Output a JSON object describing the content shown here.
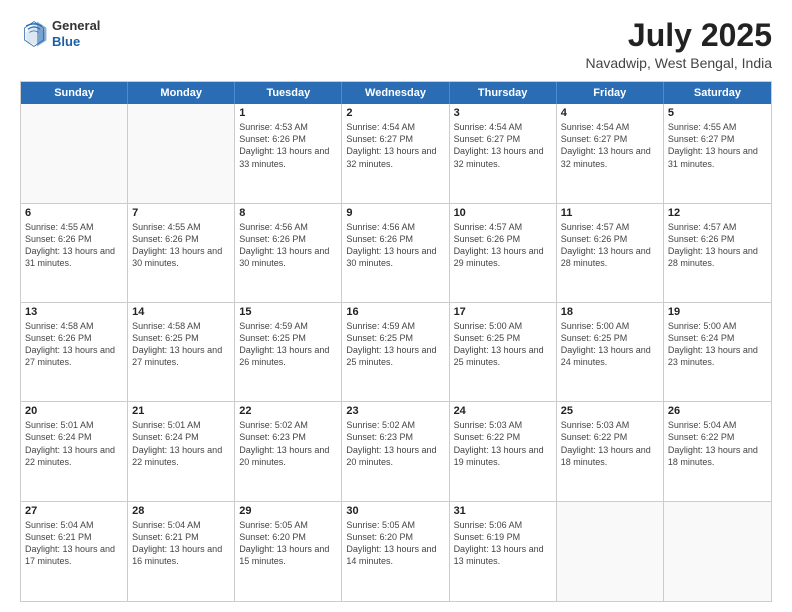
{
  "logo": {
    "general": "General",
    "blue": "Blue"
  },
  "title": {
    "month_year": "July 2025",
    "location": "Navadwip, West Bengal, India"
  },
  "header_days": [
    "Sunday",
    "Monday",
    "Tuesday",
    "Wednesday",
    "Thursday",
    "Friday",
    "Saturday"
  ],
  "weeks": [
    [
      {
        "day": "",
        "sunrise": "",
        "sunset": "",
        "daylight": ""
      },
      {
        "day": "",
        "sunrise": "",
        "sunset": "",
        "daylight": ""
      },
      {
        "day": "1",
        "sunrise": "Sunrise: 4:53 AM",
        "sunset": "Sunset: 6:26 PM",
        "daylight": "Daylight: 13 hours and 33 minutes."
      },
      {
        "day": "2",
        "sunrise": "Sunrise: 4:54 AM",
        "sunset": "Sunset: 6:27 PM",
        "daylight": "Daylight: 13 hours and 32 minutes."
      },
      {
        "day": "3",
        "sunrise": "Sunrise: 4:54 AM",
        "sunset": "Sunset: 6:27 PM",
        "daylight": "Daylight: 13 hours and 32 minutes."
      },
      {
        "day": "4",
        "sunrise": "Sunrise: 4:54 AM",
        "sunset": "Sunset: 6:27 PM",
        "daylight": "Daylight: 13 hours and 32 minutes."
      },
      {
        "day": "5",
        "sunrise": "Sunrise: 4:55 AM",
        "sunset": "Sunset: 6:27 PM",
        "daylight": "Daylight: 13 hours and 31 minutes."
      }
    ],
    [
      {
        "day": "6",
        "sunrise": "Sunrise: 4:55 AM",
        "sunset": "Sunset: 6:26 PM",
        "daylight": "Daylight: 13 hours and 31 minutes."
      },
      {
        "day": "7",
        "sunrise": "Sunrise: 4:55 AM",
        "sunset": "Sunset: 6:26 PM",
        "daylight": "Daylight: 13 hours and 30 minutes."
      },
      {
        "day": "8",
        "sunrise": "Sunrise: 4:56 AM",
        "sunset": "Sunset: 6:26 PM",
        "daylight": "Daylight: 13 hours and 30 minutes."
      },
      {
        "day": "9",
        "sunrise": "Sunrise: 4:56 AM",
        "sunset": "Sunset: 6:26 PM",
        "daylight": "Daylight: 13 hours and 30 minutes."
      },
      {
        "day": "10",
        "sunrise": "Sunrise: 4:57 AM",
        "sunset": "Sunset: 6:26 PM",
        "daylight": "Daylight: 13 hours and 29 minutes."
      },
      {
        "day": "11",
        "sunrise": "Sunrise: 4:57 AM",
        "sunset": "Sunset: 6:26 PM",
        "daylight": "Daylight: 13 hours and 28 minutes."
      },
      {
        "day": "12",
        "sunrise": "Sunrise: 4:57 AM",
        "sunset": "Sunset: 6:26 PM",
        "daylight": "Daylight: 13 hours and 28 minutes."
      }
    ],
    [
      {
        "day": "13",
        "sunrise": "Sunrise: 4:58 AM",
        "sunset": "Sunset: 6:26 PM",
        "daylight": "Daylight: 13 hours and 27 minutes."
      },
      {
        "day": "14",
        "sunrise": "Sunrise: 4:58 AM",
        "sunset": "Sunset: 6:25 PM",
        "daylight": "Daylight: 13 hours and 27 minutes."
      },
      {
        "day": "15",
        "sunrise": "Sunrise: 4:59 AM",
        "sunset": "Sunset: 6:25 PM",
        "daylight": "Daylight: 13 hours and 26 minutes."
      },
      {
        "day": "16",
        "sunrise": "Sunrise: 4:59 AM",
        "sunset": "Sunset: 6:25 PM",
        "daylight": "Daylight: 13 hours and 25 minutes."
      },
      {
        "day": "17",
        "sunrise": "Sunrise: 5:00 AM",
        "sunset": "Sunset: 6:25 PM",
        "daylight": "Daylight: 13 hours and 25 minutes."
      },
      {
        "day": "18",
        "sunrise": "Sunrise: 5:00 AM",
        "sunset": "Sunset: 6:25 PM",
        "daylight": "Daylight: 13 hours and 24 minutes."
      },
      {
        "day": "19",
        "sunrise": "Sunrise: 5:00 AM",
        "sunset": "Sunset: 6:24 PM",
        "daylight": "Daylight: 13 hours and 23 minutes."
      }
    ],
    [
      {
        "day": "20",
        "sunrise": "Sunrise: 5:01 AM",
        "sunset": "Sunset: 6:24 PM",
        "daylight": "Daylight: 13 hours and 22 minutes."
      },
      {
        "day": "21",
        "sunrise": "Sunrise: 5:01 AM",
        "sunset": "Sunset: 6:24 PM",
        "daylight": "Daylight: 13 hours and 22 minutes."
      },
      {
        "day": "22",
        "sunrise": "Sunrise: 5:02 AM",
        "sunset": "Sunset: 6:23 PM",
        "daylight": "Daylight: 13 hours and 20 minutes."
      },
      {
        "day": "23",
        "sunrise": "Sunrise: 5:02 AM",
        "sunset": "Sunset: 6:23 PM",
        "daylight": "Daylight: 13 hours and 20 minutes."
      },
      {
        "day": "24",
        "sunrise": "Sunrise: 5:03 AM",
        "sunset": "Sunset: 6:22 PM",
        "daylight": "Daylight: 13 hours and 19 minutes."
      },
      {
        "day": "25",
        "sunrise": "Sunrise: 5:03 AM",
        "sunset": "Sunset: 6:22 PM",
        "daylight": "Daylight: 13 hours and 18 minutes."
      },
      {
        "day": "26",
        "sunrise": "Sunrise: 5:04 AM",
        "sunset": "Sunset: 6:22 PM",
        "daylight": "Daylight: 13 hours and 18 minutes."
      }
    ],
    [
      {
        "day": "27",
        "sunrise": "Sunrise: 5:04 AM",
        "sunset": "Sunset: 6:21 PM",
        "daylight": "Daylight: 13 hours and 17 minutes."
      },
      {
        "day": "28",
        "sunrise": "Sunrise: 5:04 AM",
        "sunset": "Sunset: 6:21 PM",
        "daylight": "Daylight: 13 hours and 16 minutes."
      },
      {
        "day": "29",
        "sunrise": "Sunrise: 5:05 AM",
        "sunset": "Sunset: 6:20 PM",
        "daylight": "Daylight: 13 hours and 15 minutes."
      },
      {
        "day": "30",
        "sunrise": "Sunrise: 5:05 AM",
        "sunset": "Sunset: 6:20 PM",
        "daylight": "Daylight: 13 hours and 14 minutes."
      },
      {
        "day": "31",
        "sunrise": "Sunrise: 5:06 AM",
        "sunset": "Sunset: 6:19 PM",
        "daylight": "Daylight: 13 hours and 13 minutes."
      },
      {
        "day": "",
        "sunrise": "",
        "sunset": "",
        "daylight": ""
      },
      {
        "day": "",
        "sunrise": "",
        "sunset": "",
        "daylight": ""
      }
    ]
  ]
}
